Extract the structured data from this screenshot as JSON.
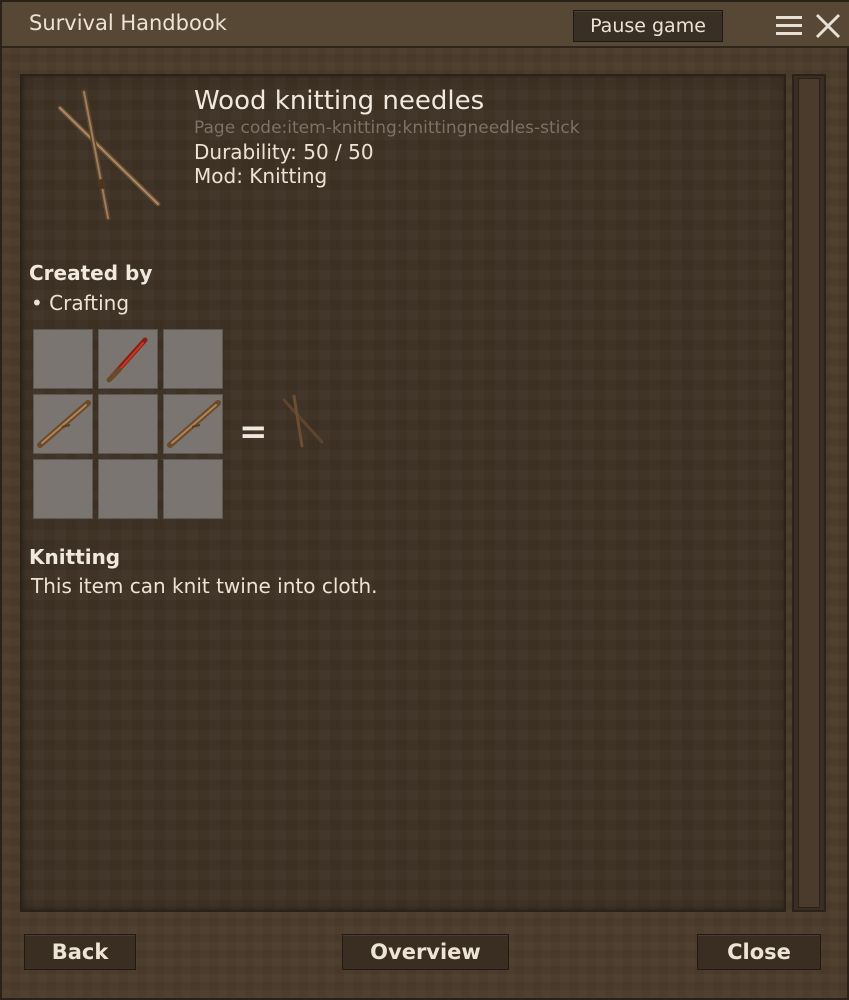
{
  "window": {
    "title": "Survival Handbook",
    "pause_label": "Pause game"
  },
  "item": {
    "name": "Wood knitting needles",
    "page_code": "Page code:item-knitting:knittingneedles-stick",
    "durability": "Durability: 50 / 50",
    "mod": "Mod: Knitting",
    "icon": "knitting-needles-icon"
  },
  "created_by": {
    "heading": "Created by",
    "method": "• Crafting",
    "grid": [
      {
        "icon": ""
      },
      {
        "icon": "knife-icon"
      },
      {
        "icon": ""
      },
      {
        "icon": "stick-icon"
      },
      {
        "icon": ""
      },
      {
        "icon": "stick-icon"
      },
      {
        "icon": ""
      },
      {
        "icon": ""
      },
      {
        "icon": ""
      }
    ],
    "equals": "=",
    "result_icon": "knitting-needles-icon"
  },
  "knitting": {
    "heading": "Knitting",
    "description": "This item can knit twine into cloth."
  },
  "footer": {
    "back_label": "Back",
    "overview_label": "Overview",
    "close_label": "Close"
  },
  "colors": {
    "background": "#4a3b2b",
    "panel": "#3f3225",
    "slot": "#7a7570",
    "muted_text": "#7d7266"
  }
}
